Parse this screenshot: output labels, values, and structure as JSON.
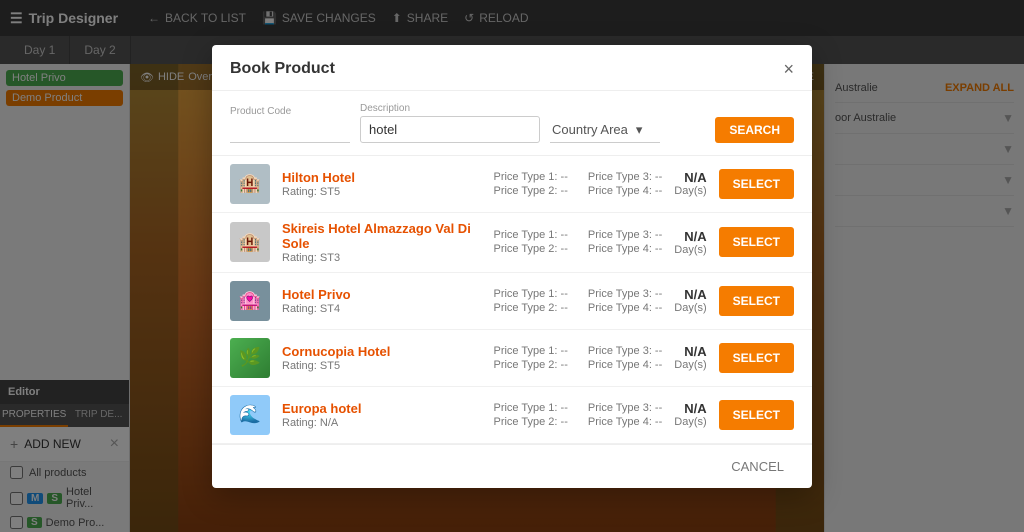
{
  "app": {
    "title": "Trip Designer",
    "top_actions": [
      {
        "id": "back",
        "label": "BACK TO LIST",
        "icon": "←"
      },
      {
        "id": "save",
        "label": "SAVE CHANGES",
        "icon": "💾"
      },
      {
        "id": "share",
        "label": "SHARE",
        "icon": "⬆"
      },
      {
        "id": "reload",
        "label": "RELOAD",
        "icon": "↺"
      }
    ],
    "view_label": "Overview",
    "hide_label": "HIDE",
    "expand_all": "EXPAND ALL"
  },
  "timeline": {
    "days": [
      "Day 1",
      "Day 2"
    ],
    "items": [
      {
        "label": "Hotel Privo",
        "color": "green"
      },
      {
        "label": "Demo Product",
        "color": "orange"
      }
    ]
  },
  "editor": {
    "label": "Editor",
    "tabs": [
      "PROPERTIES",
      "TRIP DE..."
    ],
    "active_tab": 0,
    "add_new_label": "ADD NEW",
    "all_products_label": "All products",
    "products": [
      {
        "label": "Hotel Priv...",
        "badge": "S",
        "badge_color": "green"
      },
      {
        "label": "Demo Pro...",
        "badge": "S",
        "badge_color": "green"
      }
    ]
  },
  "right_panel": {
    "items": [
      {
        "label": "Australie",
        "expanded": false
      },
      {
        "label": "oor Australie",
        "expanded": false
      },
      {
        "label": "",
        "expanded": false
      },
      {
        "label": "",
        "expanded": false
      }
    ]
  },
  "modal": {
    "title": "Book Product",
    "close_label": "×",
    "fields": {
      "product_code_label": "Product Code",
      "description_label": "Description",
      "description_value": "hotel",
      "country_area_label": "Country Area",
      "country_area_value": "Country Area"
    },
    "search_btn_label": "SEARCH",
    "cancel_btn_label": "CANCEL",
    "results": [
      {
        "id": 1,
        "name": "Hilton Hotel",
        "rating": "Rating: ST5",
        "price_type_1": "Price Type 1: --",
        "price_type_2": "Price Type 2: --",
        "price_type_3": "Price Type 3: --",
        "price_type_4": "Price Type 4: --",
        "na": "N/A",
        "days": "Day(s)",
        "select_label": "SELECT",
        "thumb_char": "🏨",
        "thumb_class": "thumb-hilton"
      },
      {
        "id": 2,
        "name": "Skireis Hotel Almazzago Val Di Sole",
        "rating": "Rating: ST3",
        "price_type_1": "Price Type 1: --",
        "price_type_2": "Price Type 2: --",
        "price_type_3": "Price Type 3: --",
        "price_type_4": "Price Type 4: --",
        "na": "N/A",
        "days": "Day(s)",
        "select_label": "SELECT",
        "thumb_char": "🏨",
        "thumb_class": "thumb-skireis"
      },
      {
        "id": 3,
        "name": "Hotel Privo",
        "rating": "Rating: ST4",
        "price_type_1": "Price Type 1: --",
        "price_type_2": "Price Type 2: --",
        "price_type_3": "Price Type 3: --",
        "price_type_4": "Price Type 4: --",
        "na": "N/A",
        "days": "Day(s)",
        "select_label": "SELECT",
        "thumb_char": "🏩",
        "thumb_class": "thumb-privo"
      },
      {
        "id": 4,
        "name": "Cornucopia Hotel",
        "rating": "Rating: ST5",
        "price_type_1": "Price Type 1: --",
        "price_type_2": "Price Type 2: --",
        "price_type_3": "Price Type 3: --",
        "price_type_4": "Price Type 4: --",
        "na": "N/A",
        "days": "Day(s)",
        "select_label": "SELECT",
        "thumb_char": "🌿",
        "thumb_class": "thumb-cornucopia"
      },
      {
        "id": 5,
        "name": "Europa hotel",
        "rating": "Rating: N/A",
        "price_type_1": "Price Type 1: --",
        "price_type_2": "Price Type 2: --",
        "price_type_3": "Price Type 3: --",
        "price_type_4": "Price Type 4: --",
        "na": "N/A",
        "days": "Day(s)",
        "select_label": "SELECT",
        "thumb_char": "🌊",
        "thumb_class": "thumb-europa"
      }
    ]
  }
}
